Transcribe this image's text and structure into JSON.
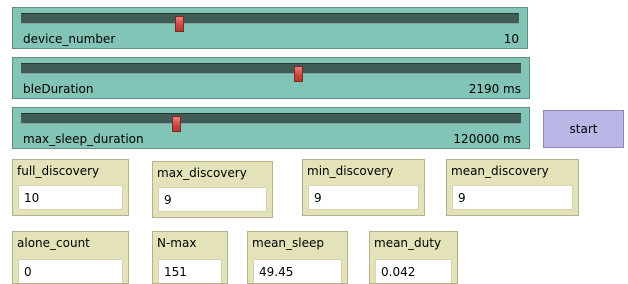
{
  "sliders": [
    {
      "label": "device_number",
      "value": "10",
      "fraction": 0.32
    },
    {
      "label": "bleDuration",
      "value": "2190 ms",
      "fraction": 0.555
    },
    {
      "label": "max_sleep_duration",
      "value": "120000 ms",
      "fraction": 0.312
    }
  ],
  "button": {
    "label": "start"
  },
  "monitors": [
    {
      "label": "full_discovery",
      "value": "10"
    },
    {
      "label": "max_discovery",
      "value": "9"
    },
    {
      "label": "min_discovery",
      "value": "9"
    },
    {
      "label": "mean_discovery",
      "value": "9"
    },
    {
      "label": "alone_count",
      "value": "0"
    },
    {
      "label": "N-max",
      "value": "151"
    },
    {
      "label": "mean_sleep",
      "value": "49.45"
    },
    {
      "label": "mean_duty",
      "value": "0.042"
    }
  ]
}
